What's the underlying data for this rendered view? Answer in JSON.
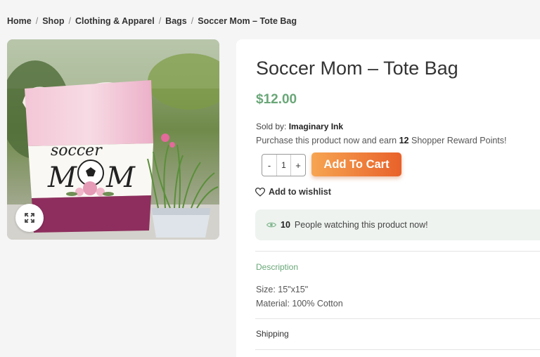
{
  "breadcrumb": {
    "items": [
      "Home",
      "Shop",
      "Clothing & Apparel",
      "Bags",
      "Soccer Mom – Tote Bag"
    ],
    "separator": "/"
  },
  "image": {
    "bag_text_top": "soccer",
    "bag_text_bottom_1": "M",
    "bag_text_bottom_2": "M"
  },
  "product": {
    "title": "Soccer Mom – Tote Bag",
    "price": "$12.00",
    "sold_by_label": "Sold by:",
    "seller": "Imaginary Ink",
    "reward_prefix": "Purchase this product now and earn",
    "reward_points": "12",
    "reward_suffix": "Shopper Reward Points!",
    "quantity": {
      "minus": "-",
      "value": "1",
      "plus": "+"
    },
    "add_to_cart": "Add To Cart",
    "wishlist": "Add to wishlist",
    "watching_count": "10",
    "watching_text": "People watching this product now!"
  },
  "tabs": {
    "description": "Description",
    "size": "Size: 15\"x15\"",
    "material": "Material: 100% Cotton",
    "shipping": "Shipping"
  },
  "colors": {
    "price_green": "#6aa778",
    "cart_orange_start": "#f6a552",
    "cart_orange_end": "#e8612a",
    "watching_bg": "#eef3ef"
  },
  "icons": [
    "expand-icon",
    "heart-icon",
    "eye-icon"
  ]
}
